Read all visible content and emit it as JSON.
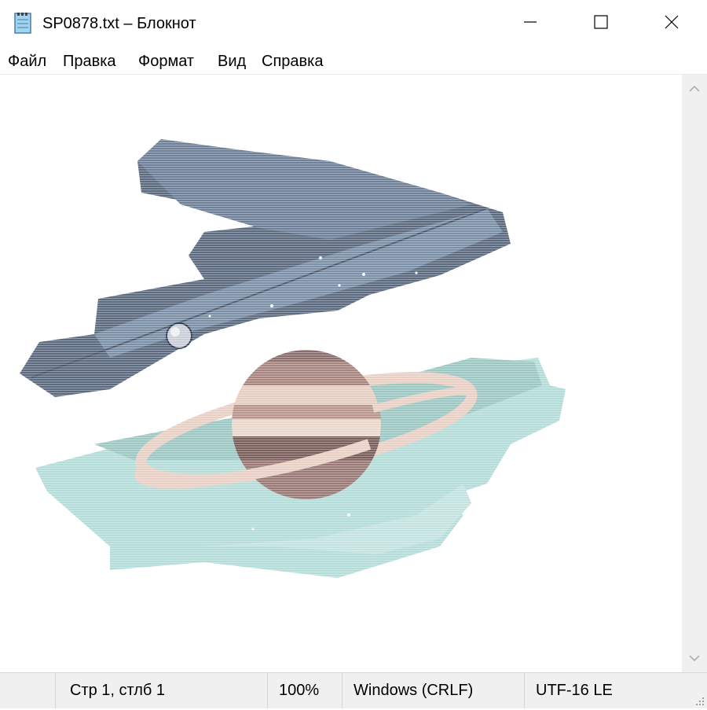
{
  "window": {
    "title": "SP0878.txt – Блокнот",
    "icons": {
      "app": "notepad-icon",
      "minimize": "minimize-icon",
      "maximize": "maximize-icon",
      "close": "close-icon"
    }
  },
  "menu": {
    "items": [
      {
        "label": "Файл"
      },
      {
        "label": "Правка"
      },
      {
        "label": "Формат"
      },
      {
        "label": "Вид"
      },
      {
        "label": "Справка"
      }
    ]
  },
  "editor": {
    "content_description_icon": "ascii-art-saturn-icon",
    "colors": {
      "sky_dark": "#5c6b80",
      "sky_mid": "#7b8fa6",
      "teal": "#9cc7c3",
      "teal_light": "#b4dcd9",
      "planet": "#8a6f6c",
      "ring": "#e8d0c4",
      "star": "#ffffff"
    }
  },
  "status": {
    "position": "Стр 1, стлб 1",
    "zoom": "100%",
    "line_ending": "Windows (CRLF)",
    "encoding": "UTF-16 LE"
  }
}
